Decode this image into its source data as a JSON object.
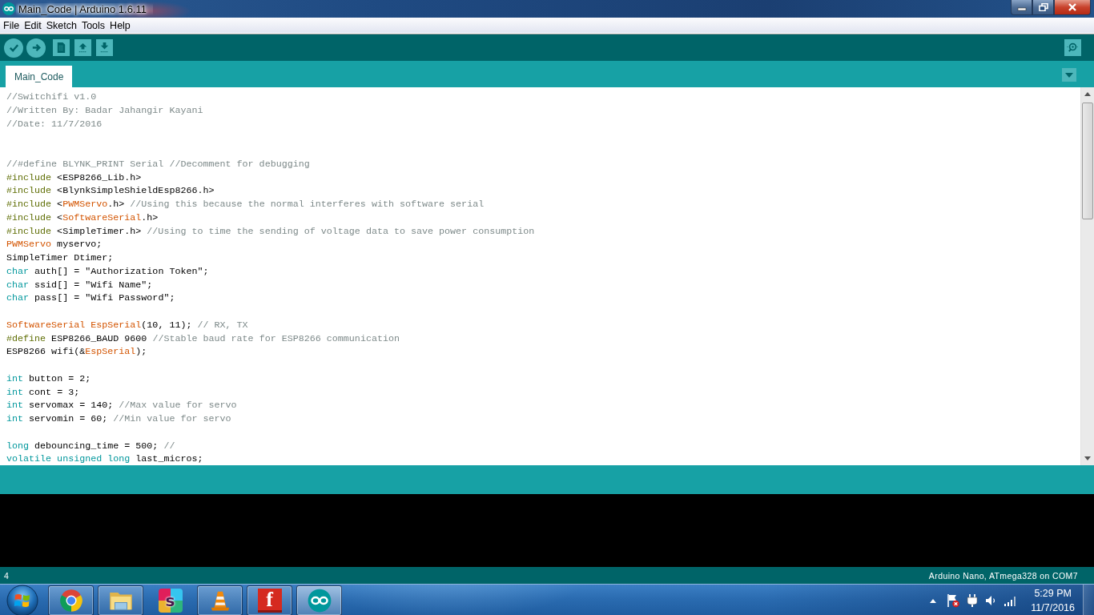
{
  "window": {
    "title": "Main_Code | Arduino 1.6.11"
  },
  "menu": [
    "File",
    "Edit",
    "Sketch",
    "Tools",
    "Help"
  ],
  "tabs": [
    {
      "label": "Main_Code",
      "selected": true
    }
  ],
  "code": [
    {
      "kind": "code",
      "tokens": [
        {
          "kind": "comment",
          "text": "//Switchifi v1.0"
        }
      ]
    },
    {
      "kind": "code",
      "tokens": [
        {
          "kind": "comment",
          "text": "//Written By: Badar Jahangir Kayani"
        }
      ]
    },
    {
      "kind": "code",
      "tokens": [
        {
          "kind": "comment",
          "text": "//Date: 11/7/2016"
        }
      ]
    },
    {
      "kind": "blank"
    },
    {
      "kind": "blank"
    },
    {
      "kind": "code",
      "tokens": [
        {
          "kind": "comment",
          "text": "//#define BLYNK_PRINT Serial //Decomment for debugging"
        }
      ]
    },
    {
      "kind": "code",
      "tokens": [
        {
          "kind": "directive",
          "text": "#include"
        },
        {
          "kind": "plain",
          "text": " <ESP8266_Lib.h>"
        }
      ]
    },
    {
      "kind": "code",
      "tokens": [
        {
          "kind": "directive",
          "text": "#include"
        },
        {
          "kind": "plain",
          "text": " <BlynkSimpleShieldEsp8266.h>"
        }
      ]
    },
    {
      "kind": "code",
      "tokens": [
        {
          "kind": "directive",
          "text": "#include"
        },
        {
          "kind": "plain",
          "text": " <"
        },
        {
          "kind": "class",
          "text": "PWMServo"
        },
        {
          "kind": "plain",
          "text": ".h> "
        },
        {
          "kind": "comment",
          "text": "//Using this because the normal interferes with software serial"
        }
      ]
    },
    {
      "kind": "code",
      "tokens": [
        {
          "kind": "directive",
          "text": "#include"
        },
        {
          "kind": "plain",
          "text": " <"
        },
        {
          "kind": "class",
          "text": "SoftwareSerial"
        },
        {
          "kind": "plain",
          "text": ".h>"
        }
      ]
    },
    {
      "kind": "code",
      "tokens": [
        {
          "kind": "directive",
          "text": "#include"
        },
        {
          "kind": "plain",
          "text": " <SimpleTimer.h> "
        },
        {
          "kind": "comment",
          "text": "//Using to time the sending of voltage data to save power consumption"
        }
      ]
    },
    {
      "kind": "code",
      "tokens": [
        {
          "kind": "class",
          "text": "PWMServo"
        },
        {
          "kind": "plain",
          "text": " myservo;"
        }
      ]
    },
    {
      "kind": "code",
      "tokens": [
        {
          "kind": "plain",
          "text": "SimpleTimer Dtimer;"
        }
      ]
    },
    {
      "kind": "code",
      "tokens": [
        {
          "kind": "keyword",
          "text": "char"
        },
        {
          "kind": "plain",
          "text": " auth[] = \"Authorization Token\";"
        }
      ]
    },
    {
      "kind": "code",
      "tokens": [
        {
          "kind": "keyword",
          "text": "char"
        },
        {
          "kind": "plain",
          "text": " ssid[] = \"Wifi Name\";"
        }
      ]
    },
    {
      "kind": "code",
      "tokens": [
        {
          "kind": "keyword",
          "text": "char"
        },
        {
          "kind": "plain",
          "text": " pass[] = \"Wifi Password\";"
        }
      ]
    },
    {
      "kind": "blank"
    },
    {
      "kind": "code",
      "tokens": [
        {
          "kind": "class",
          "text": "SoftwareSerial"
        },
        {
          "kind": "class",
          "text": " EspSerial"
        },
        {
          "kind": "plain",
          "text": "(10, 11); "
        },
        {
          "kind": "comment",
          "text": "// RX, TX"
        }
      ]
    },
    {
      "kind": "code",
      "tokens": [
        {
          "kind": "directive",
          "text": "#define"
        },
        {
          "kind": "plain",
          "text": " ESP8266_BAUD 9600 "
        },
        {
          "kind": "comment",
          "text": "//Stable baud rate for ESP8266 communication"
        }
      ]
    },
    {
      "kind": "code",
      "tokens": [
        {
          "kind": "plain",
          "text": "ESP8266 wifi(&"
        },
        {
          "kind": "class",
          "text": "EspSerial"
        },
        {
          "kind": "plain",
          "text": ");"
        }
      ]
    },
    {
      "kind": "blank"
    },
    {
      "kind": "code",
      "tokens": [
        {
          "kind": "keyword",
          "text": "int"
        },
        {
          "kind": "plain",
          "text": " button = 2;"
        }
      ]
    },
    {
      "kind": "code",
      "tokens": [
        {
          "kind": "keyword",
          "text": "int"
        },
        {
          "kind": "plain",
          "text": " cont = 3;"
        }
      ]
    },
    {
      "kind": "code",
      "tokens": [
        {
          "kind": "keyword",
          "text": "int"
        },
        {
          "kind": "plain",
          "text": " servomax = 140; "
        },
        {
          "kind": "comment",
          "text": "//Max value for servo"
        }
      ]
    },
    {
      "kind": "code",
      "tokens": [
        {
          "kind": "keyword",
          "text": "int"
        },
        {
          "kind": "plain",
          "text": " servomin = 60; "
        },
        {
          "kind": "comment",
          "text": "//Min value for servo"
        }
      ]
    },
    {
      "kind": "blank"
    },
    {
      "kind": "code",
      "tokens": [
        {
          "kind": "keyword",
          "text": "long"
        },
        {
          "kind": "plain",
          "text": " debouncing_time = 500; "
        },
        {
          "kind": "comment",
          "text": "//"
        }
      ]
    },
    {
      "kind": "code",
      "tokens": [
        {
          "kind": "keyword",
          "text": "volatile"
        },
        {
          "kind": "keyword",
          "text": " unsigned"
        },
        {
          "kind": "keyword",
          "text": " long"
        },
        {
          "kind": "plain",
          "text": " last_micros;"
        }
      ]
    }
  ],
  "status_bar": {
    "line": "4",
    "board": "Arduino Nano, ATmega328 on COM7"
  },
  "taskbar": {
    "apps": [
      {
        "running": true,
        "active": false
      },
      {
        "running": true,
        "active": false
      },
      {
        "running": false,
        "active": false,
        "glyph": "s"
      },
      {
        "running": true,
        "active": false
      },
      {
        "running": true,
        "active": false,
        "glyph": "f"
      },
      {
        "running": true,
        "active": true
      }
    ],
    "clock": {
      "time": "5:29 PM",
      "date": "11/7/2016"
    }
  }
}
